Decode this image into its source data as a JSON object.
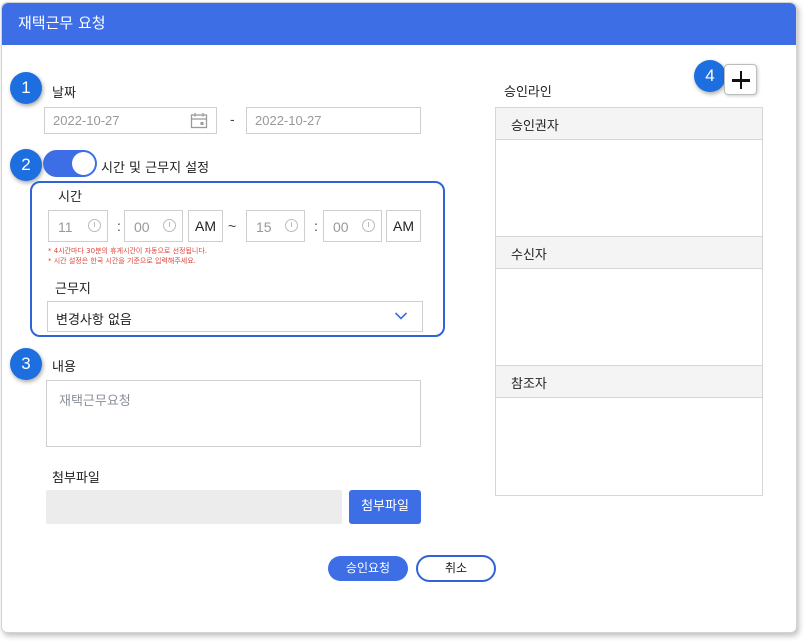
{
  "header": {
    "title": "재택근무 요청"
  },
  "badges": [
    "1",
    "2",
    "3",
    "4"
  ],
  "date": {
    "label": "날짜",
    "start": "2022-10-27",
    "separator": "-",
    "end": "2022-10-27"
  },
  "time_setting": {
    "toggle_label": "시간 및 근무지 설정",
    "toggle_on": true,
    "time_label": "시간",
    "start_hour": "11",
    "start_minute": "00",
    "start_ampm": "AM",
    "range_sep": "~",
    "end_hour": "15",
    "end_minute": "00",
    "end_ampm": "AM",
    "colon": ":",
    "note1": "* 4시간마다 30분의 휴게시간이 자동으로 선정됩니다.",
    "note2": "* 시간 설정은 한국 시간을 기준으로 입력해주세요.",
    "workplace_label": "근무지",
    "workplace_value": "변경사항 없음"
  },
  "content": {
    "label": "내용",
    "placeholder": "재택근무요청"
  },
  "attachment": {
    "label": "첨부파일",
    "button": "첨부파일"
  },
  "approval": {
    "title": "승인라인",
    "panels": [
      "승인권자",
      "수신자",
      "참조자"
    ]
  },
  "footer": {
    "approve": "승인요청",
    "cancel": "취소"
  },
  "colors": {
    "accent": "#3d6ee6",
    "badge": "#1d6fe0",
    "note": "#e0443b"
  }
}
